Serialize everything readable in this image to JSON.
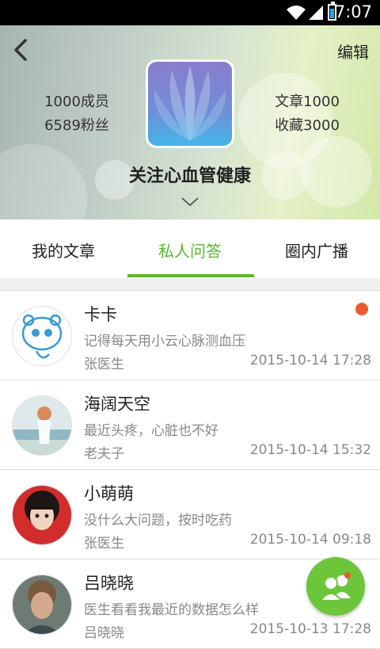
{
  "status": {
    "time": "7:07"
  },
  "header": {
    "edit_label": "编辑",
    "members": "1000成员",
    "fans": "6589粉丝",
    "articles": "文章1000",
    "favorites": "收藏3000",
    "group_name": "关注心血管健康"
  },
  "tabs": [
    {
      "label": "我的文章",
      "active": false
    },
    {
      "label": "私人问答",
      "active": true
    },
    {
      "label": "圈内广播",
      "active": false
    }
  ],
  "colors": {
    "accent": "#59b82a",
    "unread": "#ee5a2f",
    "fab": "#6cc63a"
  },
  "messages": [
    {
      "name": "卡卡",
      "message": "记得每天用小云心脉测血压",
      "doctor": "张医生",
      "time": "2015-10-14 17:28",
      "unread": true
    },
    {
      "name": "海阔天空",
      "message": "最近头疼，心脏也不好",
      "doctor": "老夫子",
      "time": "2015-10-14 15:32",
      "unread": false
    },
    {
      "name": "小萌萌",
      "message": "没什么大问题，按时吃药",
      "doctor": "张医生",
      "time": "2015-10-14 09:18",
      "unread": false
    },
    {
      "name": "吕晓晓",
      "message": "医生看看我最近的数据怎么样",
      "doctor": "吕晓晓",
      "time": "2015-10-13 17:28",
      "unread": false
    }
  ],
  "icons": {
    "back": "chevron-left-icon",
    "expand": "chevron-down-icon",
    "fab": "contacts-icon"
  }
}
